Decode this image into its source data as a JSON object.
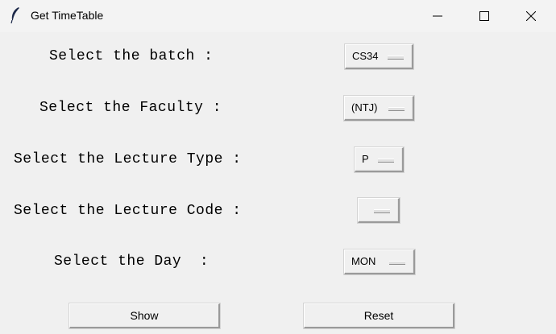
{
  "window": {
    "title": "Get TimeTable",
    "icon": "feather-icon"
  },
  "titlebar_buttons": {
    "minimize": "minimize-icon",
    "maximize": "maximize-icon",
    "close": "close-icon"
  },
  "form": {
    "batch_label": "Select the batch :",
    "batch_value": "CS34",
    "faculty_label": "Select the Faculty :",
    "faculty_value": "(NTJ)",
    "lecture_type_label": "Select the Lecture Type :",
    "lecture_type_value": "P",
    "lecture_code_label": "Select the Lecture Code :",
    "lecture_code_value": "",
    "day_label": "Select the Day  :",
    "day_value": "MON"
  },
  "buttons": {
    "show": "Show",
    "reset": "Reset"
  }
}
